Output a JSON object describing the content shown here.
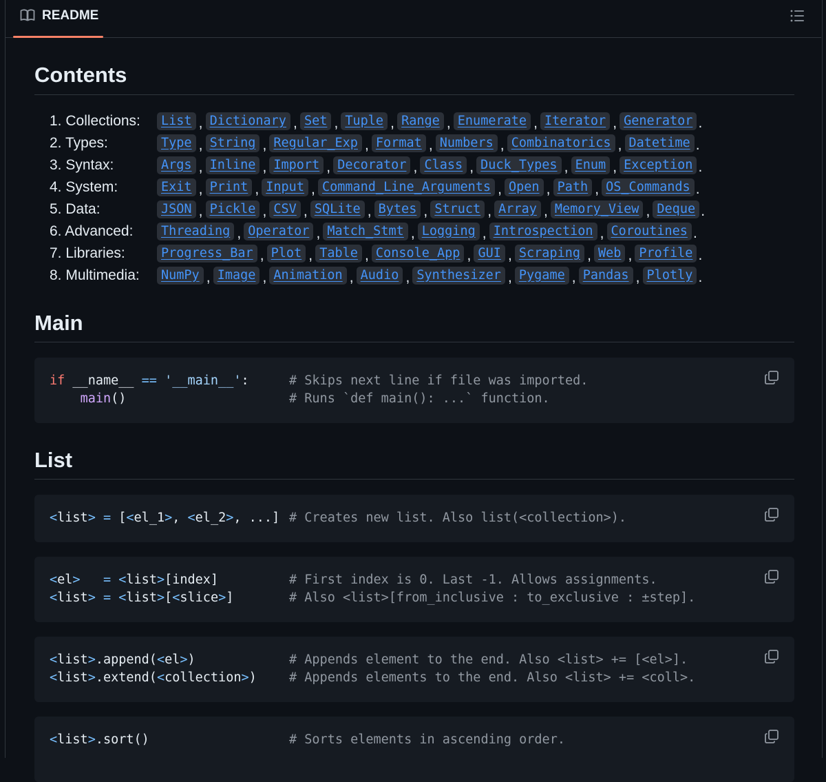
{
  "header": {
    "readme_label": "README",
    "book_icon": "book-icon",
    "toc_icon": "list-unordered-icon",
    "accent": "#f78166"
  },
  "contents": {
    "title": "Contents",
    "rows": [
      {
        "category": "1. Collections:",
        "links": [
          "List",
          "Dictionary",
          "Set",
          "Tuple",
          "Range",
          "Enumerate",
          "Iterator",
          "Generator"
        ]
      },
      {
        "category": "2. Types:",
        "links": [
          "Type",
          "String",
          "Regular_Exp",
          "Format",
          "Numbers",
          "Combinatorics",
          "Datetime"
        ]
      },
      {
        "category": "3. Syntax:",
        "links": [
          "Args",
          "Inline",
          "Import",
          "Decorator",
          "Class",
          "Duck_Types",
          "Enum",
          "Exception"
        ]
      },
      {
        "category": "4. System:",
        "links": [
          "Exit",
          "Print",
          "Input",
          "Command_Line_Arguments",
          "Open",
          "Path",
          "OS_Commands"
        ]
      },
      {
        "category": "5. Data:",
        "links": [
          "JSON",
          "Pickle",
          "CSV",
          "SQLite",
          "Bytes",
          "Struct",
          "Array",
          "Memory_View",
          "Deque"
        ]
      },
      {
        "category": "6. Advanced:",
        "links": [
          "Threading",
          "Operator",
          "Match_Stmt",
          "Logging",
          "Introspection",
          "Coroutines"
        ]
      },
      {
        "category": "7. Libraries:",
        "links": [
          "Progress_Bar",
          "Plot",
          "Table",
          "Console_App",
          "GUI",
          "Scraping",
          "Web",
          "Profile"
        ]
      },
      {
        "category": "8. Multimedia:",
        "links": [
          "NumPy",
          "Image",
          "Animation",
          "Audio",
          "Synthesizer",
          "Pygame",
          "Pandas",
          "Plotly"
        ]
      }
    ]
  },
  "main": {
    "title": "Main",
    "code": {
      "line1": {
        "kw": "if",
        "name": " __name__ ",
        "op": "==",
        "str": " '__main__'",
        "colon": ":"
      },
      "line2": {
        "fn": "main",
        "parens": "()"
      },
      "comments": [
        "# Skips next line if file was imported.",
        "# Runs `def main(): ...` function."
      ]
    }
  },
  "list": {
    "title": "List",
    "blocks": [
      {
        "lines": [
          "<list> = [<el_1>, <el_2>, ...]"
        ],
        "comments": [
          "# Creates new list. Also list(<collection>)."
        ]
      },
      {
        "lines": [
          "<el>   = <list>[index]",
          "<list> = <list>[<slice>]"
        ],
        "comments": [
          "# First index is 0. Last -1. Allows assignments.",
          "# Also <list>[from_inclusive : to_exclusive : ±step]."
        ]
      },
      {
        "lines": [
          "<list>.append(<el>)",
          "<list>.extend(<collection>)"
        ],
        "comments": [
          "# Appends element to the end. Also <list> += [<el>].",
          "# Appends elements to the end. Also <list> += <coll>."
        ]
      },
      {
        "lines": [
          "<list>.sort()"
        ],
        "comments": [
          "# Sorts elements in ascending order."
        ]
      }
    ]
  },
  "copy_icon": "copy-icon"
}
